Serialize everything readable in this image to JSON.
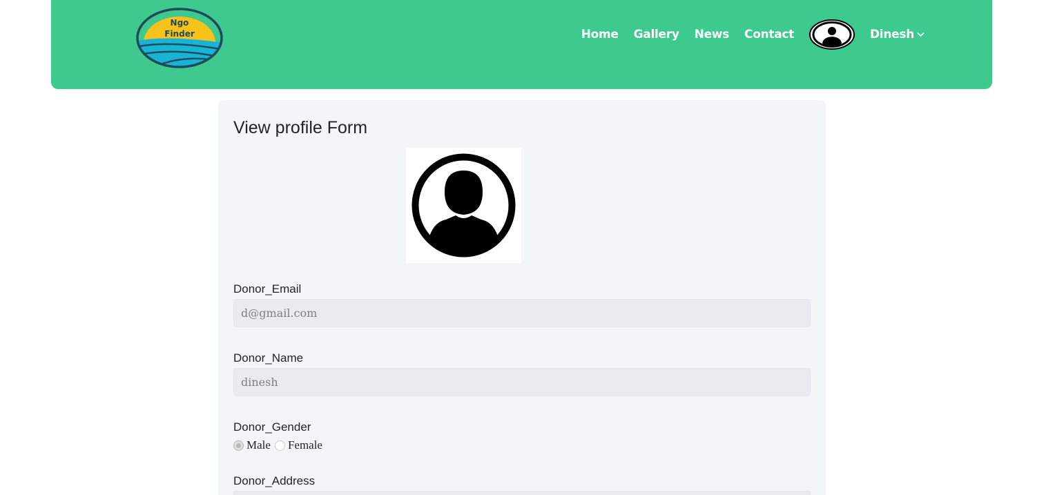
{
  "header": {
    "logo_text_line1": "Ngo",
    "logo_text_line2": "Finder",
    "nav": [
      {
        "label": "Home"
      },
      {
        "label": "Gallery"
      },
      {
        "label": "News"
      },
      {
        "label": "Contact"
      }
    ],
    "avatar_icon": "user-avatar-icon",
    "user_name": "Dinesh",
    "user_menu_icon": "chevron-down-icon"
  },
  "form": {
    "title": "View profile Form",
    "profile_image_icon": "user-circle-icon",
    "email": {
      "label": "Donor_Email",
      "value": "d@gmail.com"
    },
    "name": {
      "label": "Donor_Name",
      "value": "dinesh"
    },
    "gender": {
      "label": "Donor_Gender",
      "options": [
        {
          "label": "Male",
          "selected": true
        },
        {
          "label": "Female",
          "selected": false
        }
      ]
    },
    "address": {
      "label": "Donor_Address",
      "value": ""
    }
  },
  "colors": {
    "navbar": "#3ec98e",
    "card": "#f2f6f7",
    "input_disabled": "#e9ecef",
    "logo_yellow": "#f9c21a",
    "logo_blue": "#17b4d6",
    "logo_outline": "#1f4b5a"
  }
}
